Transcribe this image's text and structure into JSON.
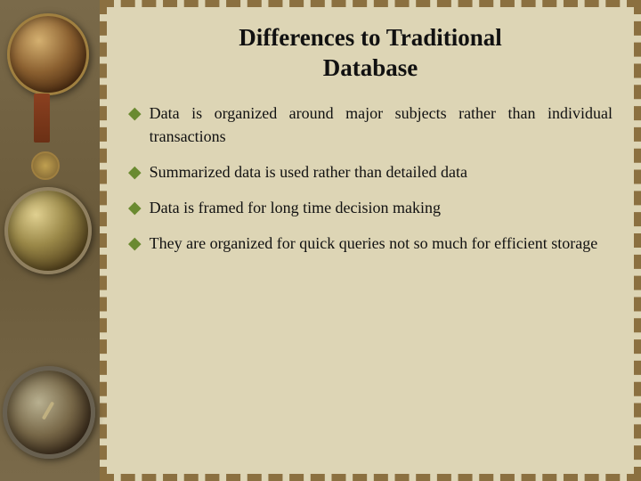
{
  "slide": {
    "title_line1": "Differences to Traditional",
    "title_line2": "Database",
    "bullets": [
      {
        "id": 1,
        "text": "Data  is  organized  around  major  subjects rather  than  individual  transactions"
      },
      {
        "id": 2,
        "text": "Summarized  data  is  used  rather  than detailed data"
      },
      {
        "id": 3,
        "text": "Data  is  framed  for  long  time  decision making"
      },
      {
        "id": 4,
        "text": "They are organized for quick queries not so much for efficient storage"
      }
    ],
    "bullet_symbol": "◆"
  },
  "colors": {
    "background": "#d8ccb0",
    "border": "#8b7040",
    "title": "#1a1a1a",
    "bullet": "#1a1a1a",
    "diamond": "#6b8c3a"
  }
}
